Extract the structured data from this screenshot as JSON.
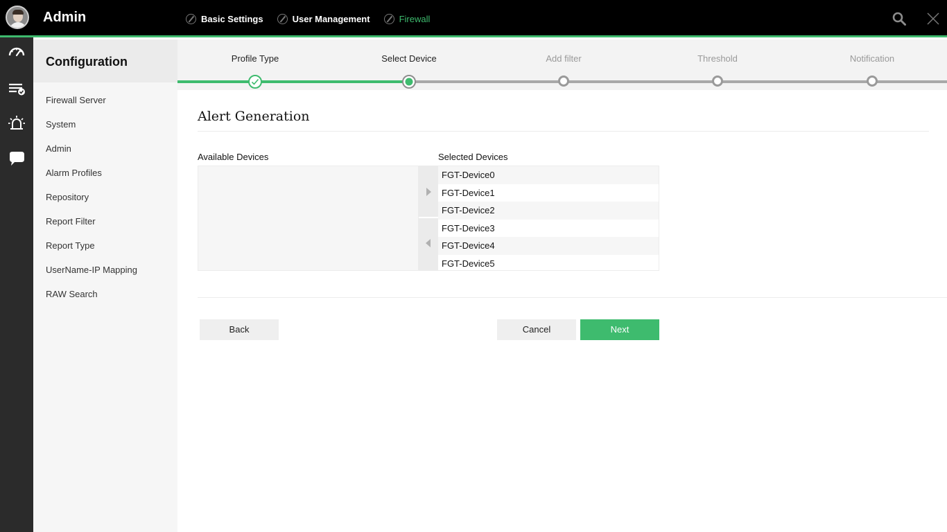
{
  "header": {
    "title": "Admin",
    "tabs": [
      {
        "label": "Basic Settings",
        "icon": "check-circle-icon"
      },
      {
        "label": "User Management",
        "icon": "check-circle-icon"
      },
      {
        "label": "Firewall",
        "icon": "check-circle-icon",
        "active": true
      }
    ],
    "actions": [
      "search-icon",
      "close-icon"
    ]
  },
  "rail": {
    "icons": [
      "speedometer-icon",
      "task-list-icon",
      "alarm-icon",
      "chat-bubble-icon"
    ]
  },
  "sidebar": {
    "title": "Configuration",
    "items": [
      {
        "label": "Firewall Server"
      },
      {
        "label": "System"
      },
      {
        "label": "Admin"
      },
      {
        "label": "Alarm Profiles"
      },
      {
        "label": "Repository"
      },
      {
        "label": "Report Filter"
      },
      {
        "label": "Report Type"
      },
      {
        "label": "UserName-IP Mapping"
      },
      {
        "label": "RAW Search"
      }
    ]
  },
  "wizard": {
    "steps": [
      {
        "label": "Profile Type",
        "status": "completed"
      },
      {
        "label": "Select Device",
        "status": "current"
      },
      {
        "label": "Add filter",
        "status": "pending"
      },
      {
        "label": "Threshold",
        "status": "pending"
      },
      {
        "label": "Notification",
        "status": "pending"
      }
    ]
  },
  "main": {
    "title": "Alert Generation",
    "available_label": "Available Devices",
    "available_devices": [],
    "selected_label": "Selected Devices",
    "selected_devices": [
      "FGT-Device0",
      "FGT-Device1",
      "FGT-Device2",
      "FGT-Device3",
      "FGT-Device4",
      "FGT-Device5"
    ],
    "back_label": "Back",
    "cancel_label": "Cancel",
    "next_label": "Next"
  },
  "colors": {
    "accent": "#3ebb6e",
    "topbar": "#000000",
    "rail": "#2b2b2b"
  }
}
